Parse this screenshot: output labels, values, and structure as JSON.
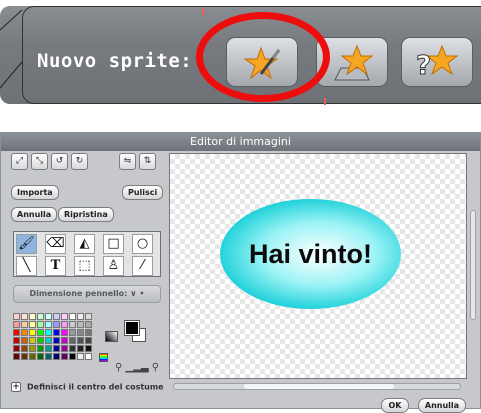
{
  "toolbar": {
    "new_sprite_label": "Nuovo sprite:",
    "buttons": [
      {
        "icon": "paint-star-icon",
        "highlighted": true
      },
      {
        "icon": "folder-star-icon"
      },
      {
        "icon": "random-star-icon"
      }
    ],
    "highlight_color": "#ee0d0d"
  },
  "editor": {
    "title": "Editor di immagini",
    "buttons": {
      "import": "Importa",
      "clear": "Pulisci",
      "undo": "Annulla",
      "redo": "Ripristina",
      "ok": "OK",
      "cancel": "Annulla"
    },
    "brush_size_label": "Dimensione pennello: ∨  •",
    "set_center_label": "Definisci il centro del costume",
    "canvas_text": "Hai vinto!",
    "tools": [
      "paintbrush",
      "eraser",
      "fill",
      "rectangle",
      "ellipse",
      "line",
      "text",
      "select",
      "stamp",
      "eyedropper"
    ],
    "selected_tool": "paintbrush",
    "ellipse_color": "#1fd1d9",
    "foreground_color": "#000000",
    "background_color": "#ffffff"
  }
}
